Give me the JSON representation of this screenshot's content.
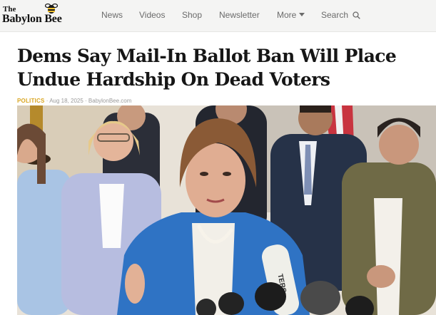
{
  "site": {
    "logo_small": "The",
    "logo_name": "Babylon Bee"
  },
  "nav": {
    "items": [
      "News",
      "Videos",
      "Shop",
      "Newsletter"
    ],
    "more_label": "More",
    "search_label": "Search"
  },
  "article": {
    "headline": "Dems Say Mail-In Ballot Ban Will Place Undue Hardship On Dead Voters",
    "category": "POLITICS",
    "date": "Aug 18, 2025",
    "source": "BabylonBee.com",
    "photo_caption_text": "TERS"
  },
  "colors": {
    "header_bg": "#f4f4f3",
    "category": "#d9a520",
    "headline": "#161616",
    "jacket_blue": "#2f73c4"
  },
  "icons": {
    "logo": "bee-icon",
    "more": "chevron-down-icon",
    "search": "search-icon"
  }
}
